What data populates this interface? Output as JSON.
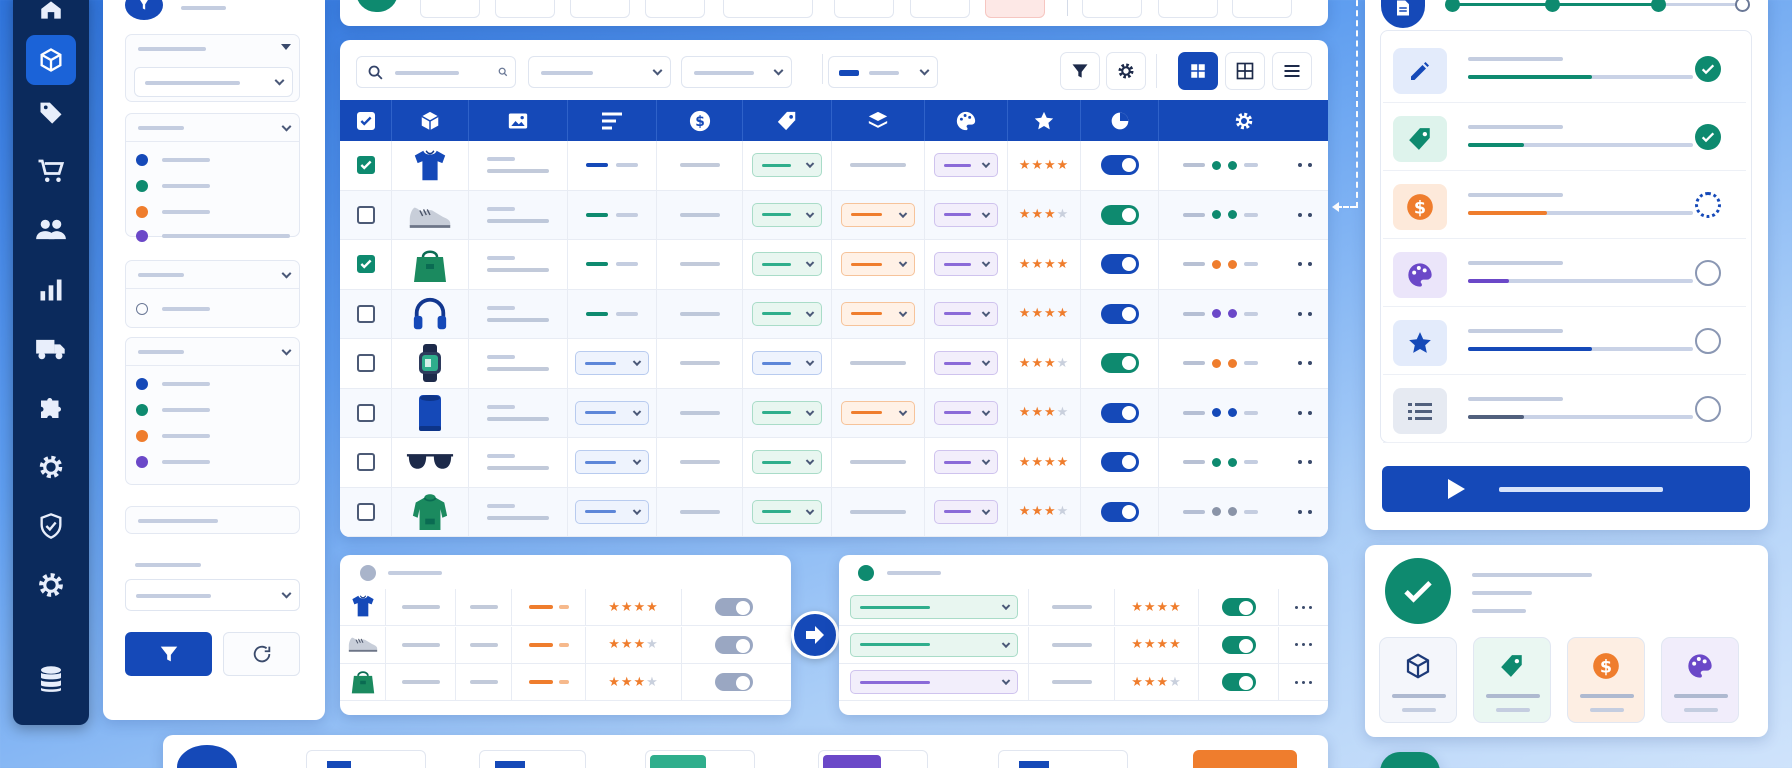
{
  "sidebar": {
    "items": [
      {
        "icon": "home-icon",
        "active": false
      },
      {
        "icon": "cube-icon",
        "active": true
      },
      {
        "icon": "tag-icon",
        "active": false
      },
      {
        "icon": "cart-icon",
        "active": false
      },
      {
        "icon": "users-icon",
        "active": false
      },
      {
        "icon": "bar-chart-icon",
        "active": false
      },
      {
        "icon": "truck-icon",
        "active": false
      },
      {
        "icon": "puzzle-icon",
        "active": false
      },
      {
        "icon": "gear-icon",
        "active": false
      },
      {
        "icon": "shield-icon",
        "active": false
      },
      {
        "icon": "settings-cog-icon",
        "active": false
      },
      {
        "icon": "database-icon",
        "active": false
      }
    ]
  },
  "filters": {
    "groups": [
      {
        "dots": [
          "#1549b8",
          "#0e8a6f",
          "#ef7d2d",
          "#6b48c8"
        ]
      },
      {
        "dots": [
          "#1549b8",
          "#0e8a6f",
          "#ef7d2d",
          "#6b48c8"
        ]
      }
    ],
    "apply_icon": "filter-icon",
    "reset_icon": "refresh-icon"
  },
  "table": {
    "columns": [
      "select",
      "cube-icon",
      "image-icon",
      "text-lines-icon",
      "dollar-icon",
      "tag-icon",
      "layers-icon",
      "palette-icon",
      "star-icon",
      "pie-chart-icon",
      "gear-icon"
    ],
    "rows": [
      {
        "checked": true,
        "product": "tshirt-icon",
        "stock_color": "#1549b8",
        "tag_type": "green",
        "layer_type": "none",
        "palette_type": "purple",
        "rating": 4,
        "toggle": "blue",
        "dots": [
          "#0e8a6f",
          "#0e8a6f"
        ]
      },
      {
        "checked": false,
        "product": "sneaker-icon",
        "stock_color": "#0e8a6f",
        "tag_type": "green",
        "layer_type": "orange",
        "palette_type": "purple",
        "rating": 3,
        "toggle": "green",
        "dots": [
          "#0e8a6f",
          "#0e8a6f"
        ]
      },
      {
        "checked": true,
        "product": "handbag-icon",
        "stock_color": "#0e8a6f",
        "tag_type": "green",
        "layer_type": "orange",
        "palette_type": "purple",
        "rating": 4,
        "toggle": "blue",
        "dots": [
          "#ef7d2d",
          "#ef7d2d"
        ]
      },
      {
        "checked": false,
        "product": "headphones-icon",
        "stock_color": "#0e8a6f",
        "tag_type": "green",
        "layer_type": "orange",
        "palette_type": "purple",
        "rating": 4,
        "toggle": "blue",
        "dots": [
          "#6b48c8",
          "#6b48c8"
        ]
      },
      {
        "checked": false,
        "product": "smartwatch-icon",
        "stock_color": "blue-pill",
        "tag_type": "blue",
        "layer_type": "none",
        "palette_type": "purple",
        "rating": 2.5,
        "toggle": "green",
        "dots": [
          "#ef7d2d",
          "#ef7d2d"
        ]
      },
      {
        "checked": false,
        "product": "speaker-icon",
        "stock_color": "blue-pill",
        "tag_type": "green",
        "layer_type": "orange",
        "palette_type": "purple",
        "rating": 3,
        "toggle": "blue",
        "dots": [
          "#1549b8",
          "#1549b8"
        ]
      },
      {
        "checked": false,
        "product": "sunglasses-icon",
        "stock_color": "blue-pill",
        "tag_type": "green",
        "layer_type": "none",
        "palette_type": "purple",
        "rating": 4,
        "toggle": "blue",
        "dots": [
          "#0e8a6f",
          "#0e8a6f"
        ]
      },
      {
        "checked": false,
        "product": "hoodie-icon",
        "stock_color": "blue-pill",
        "tag_type": "green",
        "layer_type": "none",
        "palette_type": "purple",
        "rating": 3,
        "toggle": "blue",
        "dots": [
          "#8a94a8",
          "#8a94a8"
        ]
      }
    ]
  },
  "mini_tables": {
    "left": {
      "rows": [
        {
          "product": "tshirt-icon",
          "rating": 4
        },
        {
          "product": "sneaker-icon",
          "rating": 3
        },
        {
          "product": "handbag-icon",
          "rating": 3
        }
      ]
    },
    "right": {
      "rows": [
        {
          "pill": "green",
          "rating": 4
        },
        {
          "pill": "green",
          "rating": 4
        },
        {
          "pill": "purple",
          "rating": 3
        }
      ]
    },
    "arrow_icon": "arrow-right-icon"
  },
  "steps": {
    "items": [
      {
        "icon": "pencil-icon",
        "color": "#1549b8",
        "progress": 0.55,
        "bar_color": "#0e8a6f",
        "status": "done"
      },
      {
        "icon": "tag-icon",
        "color": "#0e8a6f",
        "progress": 0.25,
        "bar_color": "#0e8a6f",
        "status": "done"
      },
      {
        "icon": "dollar-icon",
        "color": "#ef7d2d",
        "progress": 0.35,
        "bar_color": "#ef7d2d",
        "status": "loading"
      },
      {
        "icon": "palette-icon",
        "color": "#6b48c8",
        "progress": 0.18,
        "bar_color": "#6b48c8",
        "status": "pending"
      },
      {
        "icon": "star-icon",
        "color": "#1549b8",
        "progress": 0.55,
        "bar_color": "#1549b8",
        "status": "pending"
      },
      {
        "icon": "list-icon",
        "color": "#51607d",
        "progress": 0.25,
        "bar_color": "#51607d",
        "status": "pending"
      }
    ],
    "run_icon": "play-icon"
  },
  "success": {
    "icon": "check-circle-icon",
    "tiles": [
      {
        "icon": "cube-icon",
        "color": "#1d3a78"
      },
      {
        "icon": "tag-icon",
        "color": "#0e8a6f"
      },
      {
        "icon": "dollar-icon",
        "color": "#ef7d2d"
      },
      {
        "icon": "palette-icon",
        "color": "#6b48c8"
      }
    ]
  }
}
